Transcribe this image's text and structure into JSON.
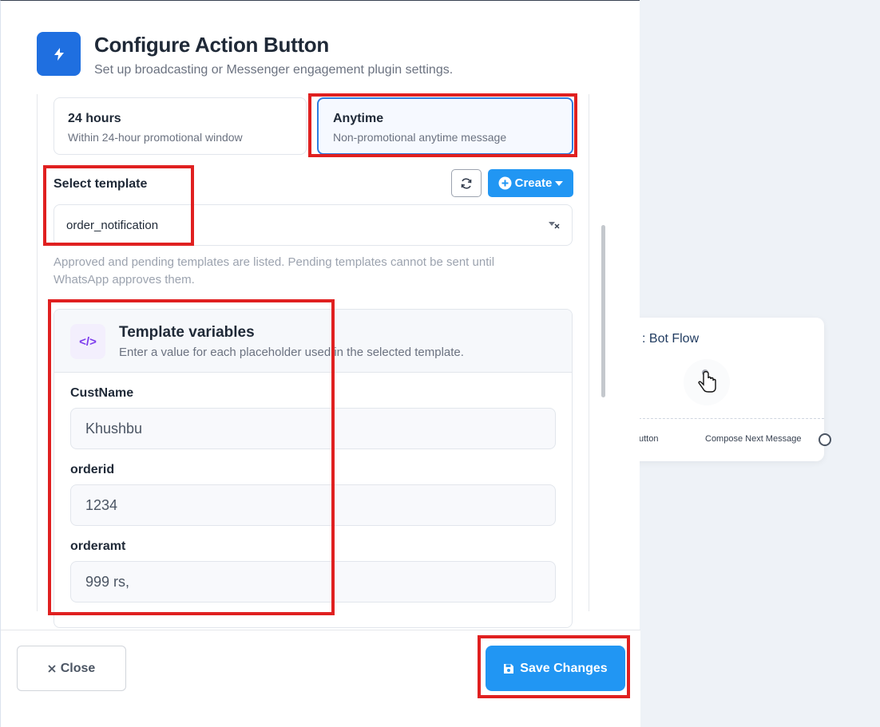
{
  "header": {
    "title": "Configure Action Button",
    "subtitle": "Set up broadcasting or Messenger engagement plugin settings."
  },
  "message_window": {
    "options": [
      {
        "title": "24 hours",
        "description": "Within 24-hour promotional window",
        "selected": false
      },
      {
        "title": "Anytime",
        "description": "Non-promotional anytime message",
        "selected": true
      }
    ]
  },
  "template_select": {
    "label": "Select template",
    "value": "order_notification",
    "create_label": "Create",
    "help_line1": "Approved and pending templates are listed. Pending templates cannot be sent until",
    "help_line2": "WhatsApp approves them."
  },
  "template_variables": {
    "title": "Template variables",
    "subtitle": "Enter a value for each placeholder used in the selected template.",
    "icon_text": "</>",
    "fields": [
      {
        "label": "CustName",
        "value": "Khushbu"
      },
      {
        "label": "orderid",
        "value": "1234"
      },
      {
        "label": "orderamt",
        "value": "999 rs,"
      }
    ]
  },
  "footer": {
    "close_label": "Close",
    "save_label": "Save Changes"
  },
  "background_flow": {
    "title": ": Bot Flow",
    "button_label": "utton",
    "next_label": "Compose Next Message"
  },
  "colors": {
    "primary": "#2196f3",
    "header_icon": "#1f6fe0",
    "highlight": "#e02020"
  }
}
